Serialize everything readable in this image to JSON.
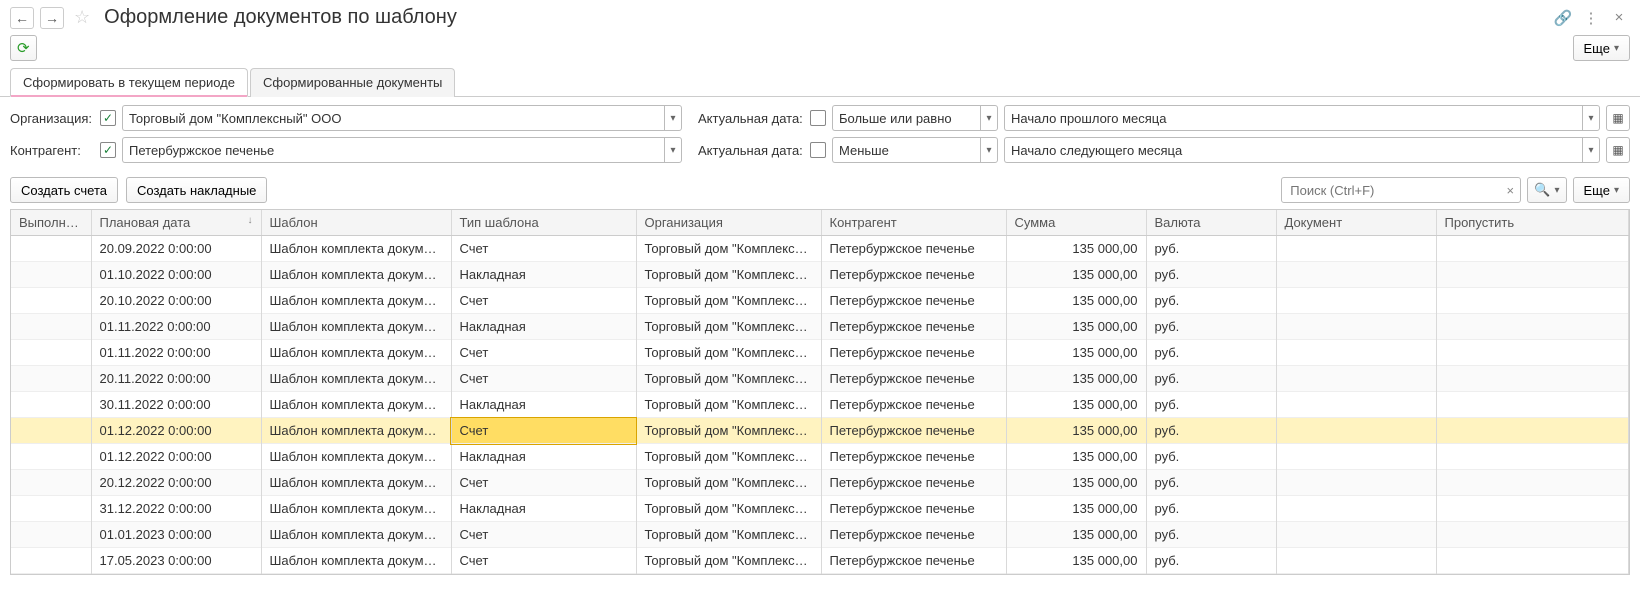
{
  "header": {
    "title": "Оформление документов по шаблону",
    "more_label": "Еще"
  },
  "tabs": [
    {
      "label": "Сформировать в текущем периоде",
      "active": true
    },
    {
      "label": "Сформированные документы",
      "active": false
    }
  ],
  "filters": {
    "org_label": "Организация:",
    "org_checked": true,
    "org_value": "Торговый дом \"Комплексный\" ООО",
    "cntr_label": "Контрагент:",
    "cntr_checked": true,
    "cntr_value": "Петербуржское печенье",
    "date_label": "Актуальная дата:",
    "date1_checked": false,
    "date1_op": "Больше или равно",
    "date1_val": "Начало прошлого месяца",
    "date2_checked": false,
    "date2_op": "Меньше",
    "date2_val": "Начало следующего месяца"
  },
  "actions": {
    "create_invoices": "Создать счета",
    "create_shipments": "Создать накладные",
    "search_placeholder": "Поиск (Ctrl+F)",
    "more_label": "Еще"
  },
  "columns": {
    "done": "Выполнено",
    "plan_date": "Плановая дата",
    "template": "Шаблон",
    "template_type": "Тип шаблона",
    "organization": "Организация",
    "counterparty": "Контрагент",
    "sum": "Сумма",
    "currency": "Валюта",
    "document": "Документ",
    "skip": "Пропустить"
  },
  "rows": [
    {
      "date": "20.09.2022 0:00:00",
      "tmpl": "Шаблон комплекта документ...",
      "type": "Счет",
      "org": "Торговый дом \"Комплексный...",
      "cntr": "Петербуржское печенье",
      "sum": "135 000,00",
      "cur": "руб."
    },
    {
      "date": "01.10.2022 0:00:00",
      "tmpl": "Шаблон комплекта документ...",
      "type": "Накладная",
      "org": "Торговый дом \"Комплексный...",
      "cntr": "Петербуржское печенье",
      "sum": "135 000,00",
      "cur": "руб."
    },
    {
      "date": "20.10.2022 0:00:00",
      "tmpl": "Шаблон комплекта документ...",
      "type": "Счет",
      "org": "Торговый дом \"Комплексный...",
      "cntr": "Петербуржское печенье",
      "sum": "135 000,00",
      "cur": "руб."
    },
    {
      "date": "01.11.2022 0:00:00",
      "tmpl": "Шаблон комплекта документ...",
      "type": "Накладная",
      "org": "Торговый дом \"Комплексный...",
      "cntr": "Петербуржское печенье",
      "sum": "135 000,00",
      "cur": "руб."
    },
    {
      "date": "01.11.2022 0:00:00",
      "tmpl": "Шаблон комплекта документ...",
      "type": "Счет",
      "org": "Торговый дом \"Комплексный...",
      "cntr": "Петербуржское печенье",
      "sum": "135 000,00",
      "cur": "руб."
    },
    {
      "date": "20.11.2022 0:00:00",
      "tmpl": "Шаблон комплекта документ...",
      "type": "Счет",
      "org": "Торговый дом \"Комплексный...",
      "cntr": "Петербуржское печенье",
      "sum": "135 000,00",
      "cur": "руб."
    },
    {
      "date": "30.11.2022 0:00:00",
      "tmpl": "Шаблон комплекта документ...",
      "type": "Накладная",
      "org": "Торговый дом \"Комплексный...",
      "cntr": "Петербуржское печенье",
      "sum": "135 000,00",
      "cur": "руб."
    },
    {
      "date": "01.12.2022 0:00:00",
      "tmpl": "Шаблон комплекта документ...",
      "type": "Счет",
      "org": "Торговый дом \"Комплексный...",
      "cntr": "Петербуржское печенье",
      "sum": "135 000,00",
      "cur": "руб.",
      "highlight": true
    },
    {
      "date": "01.12.2022 0:00:00",
      "tmpl": "Шаблон комплекта документ...",
      "type": "Накладная",
      "org": "Торговый дом \"Комплексный...",
      "cntr": "Петербуржское печенье",
      "sum": "135 000,00",
      "cur": "руб."
    },
    {
      "date": "20.12.2022 0:00:00",
      "tmpl": "Шаблон комплекта документ...",
      "type": "Счет",
      "org": "Торговый дом \"Комплексный...",
      "cntr": "Петербуржское печенье",
      "sum": "135 000,00",
      "cur": "руб."
    },
    {
      "date": "31.12.2022 0:00:00",
      "tmpl": "Шаблон комплекта документ...",
      "type": "Накладная",
      "org": "Торговый дом \"Комплексный...",
      "cntr": "Петербуржское печенье",
      "sum": "135 000,00",
      "cur": "руб."
    },
    {
      "date": "01.01.2023 0:00:00",
      "tmpl": "Шаблон комплекта документ...",
      "type": "Счет",
      "org": "Торговый дом \"Комплексный...",
      "cntr": "Петербуржское печенье",
      "sum": "135 000,00",
      "cur": "руб."
    },
    {
      "date": "17.05.2023 0:00:00",
      "tmpl": "Шаблон комплекта документ...",
      "type": "Счет",
      "org": "Торговый дом \"Комплексный...",
      "cntr": "Петербуржское печенье",
      "sum": "135 000,00",
      "cur": "руб."
    }
  ]
}
